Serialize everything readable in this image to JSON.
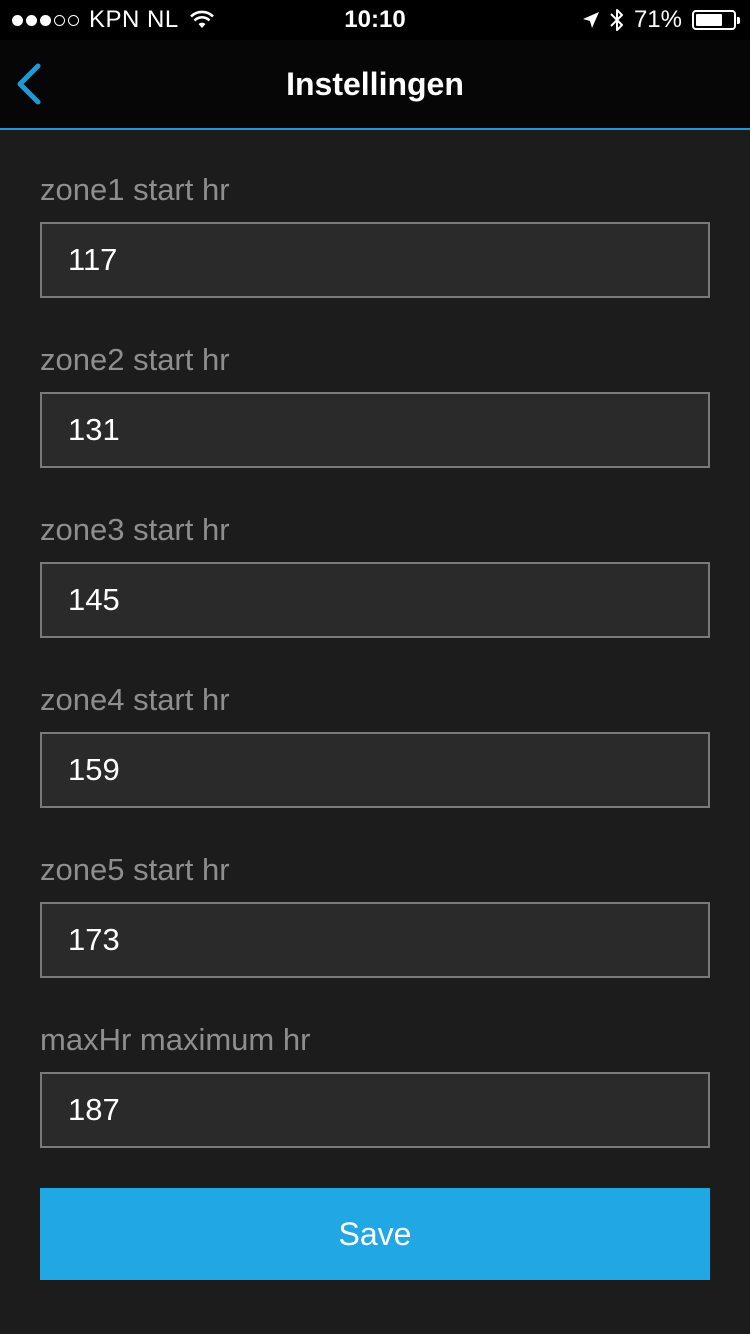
{
  "status_bar": {
    "carrier": "KPN NL",
    "time": "10:10",
    "battery": "71%",
    "battery_level": 0.71,
    "signal_bars_filled": 3,
    "signal_bars_total": 5,
    "icons": [
      "signal-dots-icon",
      "wifi-icon",
      "location-arrow-icon",
      "bluetooth-icon",
      "battery-icon"
    ]
  },
  "nav": {
    "title": "Instellingen",
    "back_icon": "chevron-left-icon",
    "accent_color": "#1e9bd7"
  },
  "fields": [
    {
      "label": "zone1 start hr",
      "value": "117"
    },
    {
      "label": "zone2 start hr",
      "value": "131"
    },
    {
      "label": "zone3 start hr",
      "value": "145"
    },
    {
      "label": "zone4 start hr",
      "value": "159"
    },
    {
      "label": "zone5 start hr",
      "value": "173"
    },
    {
      "label": "maxHr maximum hr",
      "value": "187"
    }
  ],
  "save_button": {
    "label": "Save",
    "color": "#22a7e5"
  }
}
